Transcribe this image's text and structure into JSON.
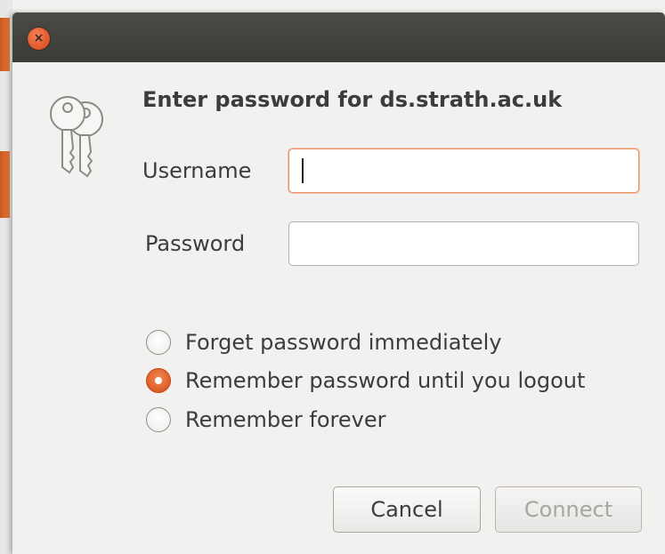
{
  "dialog": {
    "heading": "Enter password for ds.strath.ac.uk",
    "close_glyph": "×",
    "icon": "keys-icon"
  },
  "form": {
    "username_label": "Username",
    "username_value": "",
    "password_label": "Password",
    "password_value": ""
  },
  "remember_options": [
    {
      "label": "Forget password immediately",
      "selected": false
    },
    {
      "label": "Remember password until you logout",
      "selected": true
    },
    {
      "label": "Remember forever",
      "selected": false
    }
  ],
  "buttons": {
    "cancel_label": "Cancel",
    "connect_label": "Connect",
    "connect_enabled": false
  },
  "colors": {
    "accent": "#de5a22",
    "titlebar": "#3c3b37",
    "focus_border": "#e8906a"
  }
}
